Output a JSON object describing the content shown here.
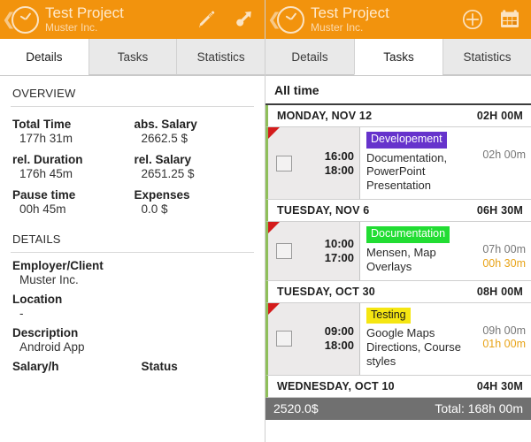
{
  "colors": {
    "accent_orange": "#f2930d",
    "tag_development": "#6633cc",
    "tag_documentation": "#22dd33",
    "tag_testing": "#f5e612",
    "flag_red": "#d41c1c",
    "duration_accent": "#e8a317",
    "bottombar": "#707070"
  },
  "left_panel": {
    "header": {
      "back_icon": "chevron-left-icon",
      "logo_icon": "clock-gauge-icon",
      "title": "Test Project",
      "subtitle": "Muster Inc.",
      "actions": [
        {
          "icon": "pencil-edit-icon",
          "label": "Edit"
        },
        {
          "icon": "pin-arrow-icon",
          "label": "Start"
        }
      ]
    },
    "tabs": [
      {
        "label": "Details",
        "active": true
      },
      {
        "label": "Tasks",
        "active": false
      },
      {
        "label": "Statistics",
        "active": false
      }
    ],
    "overview": {
      "heading": "OVERVIEW",
      "rows": [
        {
          "label": "Total Time",
          "value": "177h 31m",
          "label2": "abs. Salary",
          "value2": "2662.5 $"
        },
        {
          "label": "rel. Duration",
          "value": "176h 45m",
          "label2": "rel. Salary",
          "value2": "2651.25 $"
        },
        {
          "label": "Pause time",
          "value": "00h 45m",
          "label2": "Expenses",
          "value2": "0.0 $"
        }
      ]
    },
    "details": {
      "heading": "DETAILS",
      "fields": [
        {
          "label": "Employer/Client",
          "value": "Muster Inc."
        },
        {
          "label": "Location",
          "value": "-"
        },
        {
          "label": "Description",
          "value": "Android App"
        }
      ],
      "footer_labels": {
        "left": "Salary/h",
        "right": "Status"
      }
    }
  },
  "right_panel": {
    "header": {
      "back_icon": "chevron-left-icon",
      "logo_icon": "clock-gauge-icon",
      "title": "Test Project",
      "subtitle": "Muster Inc.",
      "actions": [
        {
          "icon": "plus-circle-icon",
          "label": "Add"
        },
        {
          "icon": "calendar-icon",
          "label": "Calendar"
        }
      ]
    },
    "tabs": [
      {
        "label": "Details",
        "active": false
      },
      {
        "label": "Tasks",
        "active": true
      },
      {
        "label": "Statistics",
        "active": false
      }
    ],
    "filter_label": "All time",
    "groups": [
      {
        "date": "MONDAY, NOV 12",
        "total": "02H 00M",
        "entry": {
          "start": "16:00",
          "end": "18:00",
          "tag": "Developement",
          "tag_color": "#6633cc",
          "tag_text_color": "#ffffff",
          "description": "Documentation, PowerPoint Presentation",
          "duration_primary": "02h 00m",
          "duration_secondary": ""
        }
      },
      {
        "date": "TUESDAY, NOV 6",
        "total": "06H 30M",
        "entry": {
          "start": "10:00",
          "end": "17:00",
          "tag": "Documentation",
          "tag_color": "#22dd33",
          "tag_text_color": "#ffffff",
          "description": "Mensen, Map Overlays",
          "duration_primary": "07h 00m",
          "duration_secondary": "00h 30m"
        }
      },
      {
        "date": "TUESDAY, OCT 30",
        "total": "08H 00M",
        "entry": {
          "start": "09:00",
          "end": "18:00",
          "tag": "Testing",
          "tag_color": "#f5e612",
          "tag_text_color": "#1a1a1a",
          "description": "Google Maps Directions, Course styles",
          "duration_primary": "09h 00m",
          "duration_secondary": "01h 00m"
        }
      },
      {
        "date": "WEDNESDAY, OCT 10",
        "total": "04H 30M",
        "entry": null
      }
    ],
    "bottom_bar": {
      "amount": "2520.0$",
      "total": "Total: 168h 00m"
    }
  }
}
